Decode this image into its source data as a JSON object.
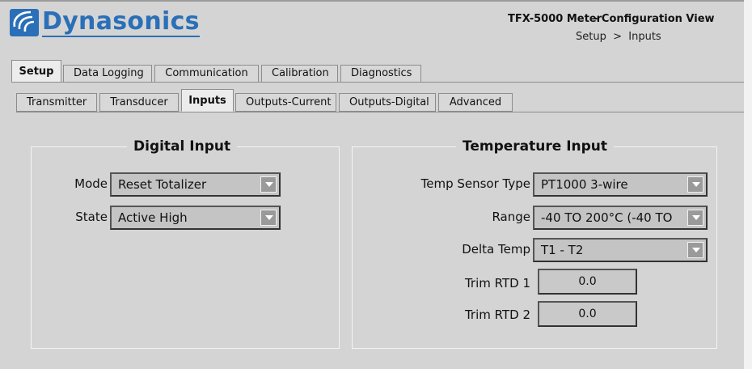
{
  "header": {
    "brand": "Dynasonics",
    "meter": "TFX-5000 Meter",
    "view": "- Configuration View",
    "breadcrumb": "Setup  >  Inputs",
    "brand_color": "#2a6fb8"
  },
  "main_tabs": [
    {
      "label": "Setup",
      "active": true
    },
    {
      "label": "Data Logging",
      "active": false
    },
    {
      "label": "Communication",
      "active": false
    },
    {
      "label": "Calibration",
      "active": false
    },
    {
      "label": "Diagnostics",
      "active": false
    }
  ],
  "sub_tabs": [
    {
      "label": "Transmitter",
      "active": false
    },
    {
      "label": "Transducer",
      "active": false
    },
    {
      "label": "Inputs",
      "active": true
    },
    {
      "label": "Outputs-Current",
      "active": false
    },
    {
      "label": "Outputs-Digital",
      "active": false
    },
    {
      "label": "Advanced",
      "active": false
    }
  ],
  "digital_input": {
    "title": "Digital Input",
    "mode_label": "Mode",
    "mode_value": "Reset Totalizer",
    "state_label": "State",
    "state_value": "Active High"
  },
  "temperature_input": {
    "title": "Temperature Input",
    "sensor_label": "Temp Sensor Type",
    "sensor_value": "PT1000 3-wire",
    "range_label": "Range",
    "range_value": "-40 TO 200°C (-40 TO",
    "delta_label": "Delta Temp",
    "delta_value": "T1 - T2",
    "trim1_label": "Trim RTD 1",
    "trim1_value": "0.0",
    "trim2_label": "Trim RTD 2",
    "trim2_value": "0.0"
  }
}
